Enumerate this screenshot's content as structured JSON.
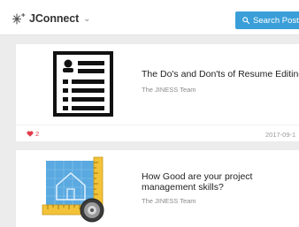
{
  "header": {
    "brand": "JConnect",
    "brand_caret": "⌄",
    "search_label": "Search Posts",
    "search_icon": "search-icon"
  },
  "posts": [
    {
      "title": "The Do's and Don'ts of Resume Editing",
      "author": "The JINESS Team",
      "likes": "2",
      "date": "2017-09-1",
      "thumbnail_icon": "resume-document-icon"
    },
    {
      "title": "How Good are your project management skills?",
      "author": "The JINESS Team",
      "thumbnail_icon": "blueprint-ruler-icon"
    }
  ],
  "colors": {
    "accent": "#3a9fd8",
    "like": "#e23c4a",
    "background": "#ececec"
  }
}
